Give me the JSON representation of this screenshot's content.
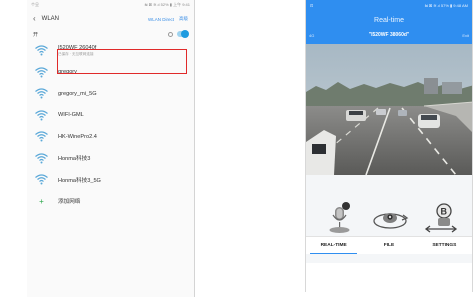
{
  "left_phone": {
    "status_left": "个旦",
    "status_right": "₦ ⊠ ≋.ıl 52% ▮ 上午 9:41",
    "header": {
      "back_glyph": "‹",
      "title": "WLAN",
      "wifi_direct": "WLAN Direct",
      "advanced": "高级"
    },
    "toggle_label": "开",
    "networks": [
      {
        "name": "I520WF 26040f",
        "sub": "已保存 · 无互联网连接",
        "highlighted": true
      },
      {
        "name": "gregory",
        "sub": "",
        "highlighted": false
      },
      {
        "name": "gregory_mi_5G",
        "sub": "",
        "highlighted": false
      },
      {
        "name": "WIFI-GML",
        "sub": "",
        "highlighted": false
      },
      {
        "name": "HK-WinePro2.4",
        "sub": "",
        "highlighted": false
      },
      {
        "name": "Honma科技3",
        "sub": "",
        "highlighted": false
      },
      {
        "name": "Honma科技3_5G",
        "sub": "",
        "highlighted": false
      }
    ],
    "add_network": "添加网络",
    "colors": {
      "accent": "#3a8ee6",
      "highlight": "#e02a2a",
      "wifi_icon": "#5aa8d8",
      "add_icon": "#2aa84a"
    }
  },
  "right_phone": {
    "status_left": "⊡",
    "status_right": "₦ ⊠ ≋.ıl 57% ▮ 9:48 AM",
    "title": "Real-time",
    "sub_left": "4G",
    "camera_name": "\"I520WF 38060d\"",
    "sub_right": "Exit",
    "tabs": [
      {
        "label": "REAL-TIME",
        "active": true
      },
      {
        "label": "FILE",
        "active": false
      },
      {
        "label": "SETTINGS",
        "active": false
      }
    ],
    "controls": [
      "voice-record-icon",
      "rotate-camera-icon",
      "switch-camera-b-icon"
    ],
    "colors": {
      "accent": "#2f8ef0",
      "controls_bg": "#f4f6f8"
    }
  }
}
